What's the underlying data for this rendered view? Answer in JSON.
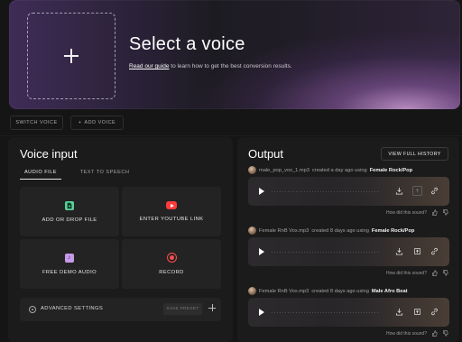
{
  "hero": {
    "title": "Select a voice",
    "guide_link": "Read our guide",
    "subtitle_rest": " to learn how to get the best conversion results."
  },
  "toolbar": {
    "switch_voice": "SWITCH VOICE",
    "add_voice": "ADD VOICE"
  },
  "voice_input": {
    "title": "Voice input",
    "tabs": [
      "AUDIO FILE",
      "TEXT TO SPEECH"
    ],
    "cards": [
      {
        "label": "ADD OR DROP FILE",
        "icon": "file-add-icon",
        "color": "#5ad09a"
      },
      {
        "label": "ENTER YOUTUBE LINK",
        "icon": "youtube-icon",
        "color": "#ff3b3b"
      },
      {
        "label": "FREE DEMO AUDIO",
        "icon": "music-note-icon",
        "color": "#c59ae8"
      },
      {
        "label": "RECORD",
        "icon": "record-icon",
        "color": "#ff4c4c"
      }
    ],
    "advanced": {
      "label": "ADVANCED SETTINGS",
      "save_preset": "SAVE PRESET"
    }
  },
  "output": {
    "title": "Output",
    "history_button": "VIEW FULL HISTORY",
    "feedback_prompt": "How did this sound?",
    "entries": [
      {
        "file": "male_pop_vox_1.mp3",
        "when": " created a day ago using ",
        "voice": "Female Rock/Pop"
      },
      {
        "file": "Female RnB Vox.mp3",
        "when": " created 8 days ago using ",
        "voice": "Female Rock/Pop"
      },
      {
        "file": "Female RnB Vox.mp3",
        "when": " created 8 days ago using ",
        "voice": "Male Afro Beat"
      }
    ]
  }
}
